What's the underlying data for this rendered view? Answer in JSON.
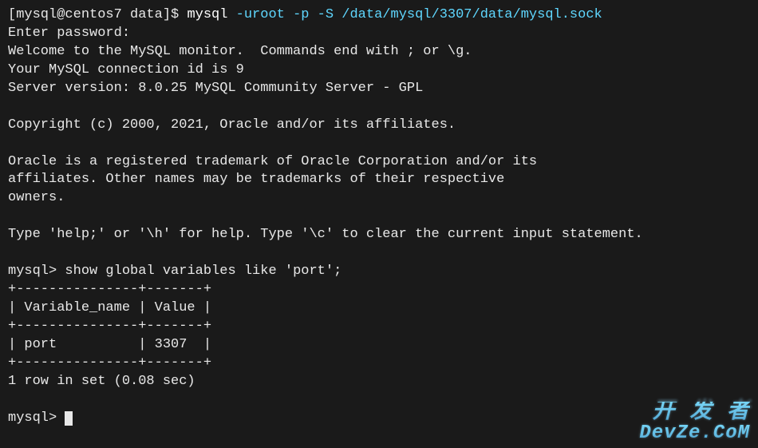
{
  "shell_prompt": "[mysql@centos7 data]$ ",
  "command": {
    "bin": "mysql",
    "args_cyan": " -uroot -p -S /data/mysql/3307/data/mysql.sock"
  },
  "welcome": {
    "line1": "Enter password:",
    "line2": "Welcome to the MySQL monitor.  Commands end with ; or \\g.",
    "line3": "Your MySQL connection id is 9",
    "line4": "Server version: 8.0.25 MySQL Community Server - GPL",
    "blank1": "",
    "copyright": "Copyright (c) 2000, 2021, Oracle and/or its affiliates.",
    "blank2": "",
    "trademark1": "Oracle is a registered trademark of Oracle Corporation and/or its",
    "trademark2": "affiliates. Other names may be trademarks of their respective",
    "trademark3": "owners.",
    "blank3": "",
    "help": "Type 'help;' or '\\h' for help. Type '\\c' to clear the current input statement.",
    "blank4": ""
  },
  "mysql_prompt": "mysql> ",
  "query": "show global variables like 'port';",
  "table": {
    "border_top": "+---------------+-------+",
    "header": "| Variable_name | Value |",
    "border_mid": "+---------------+-------+",
    "row1": "| port          | 3307  |",
    "border_bottom": "+---------------+-------+"
  },
  "result_summary": "1 row in set (0.08 sec)",
  "blank5": "",
  "watermark": {
    "top": "开 发 者",
    "bottom": "DevZe.CoM"
  },
  "chart_data": {
    "type": "table",
    "columns": [
      "Variable_name",
      "Value"
    ],
    "rows": [
      {
        "Variable_name": "port",
        "Value": "3307"
      }
    ],
    "title": "show global variables like 'port'",
    "summary": "1 row in set (0.08 sec)"
  }
}
